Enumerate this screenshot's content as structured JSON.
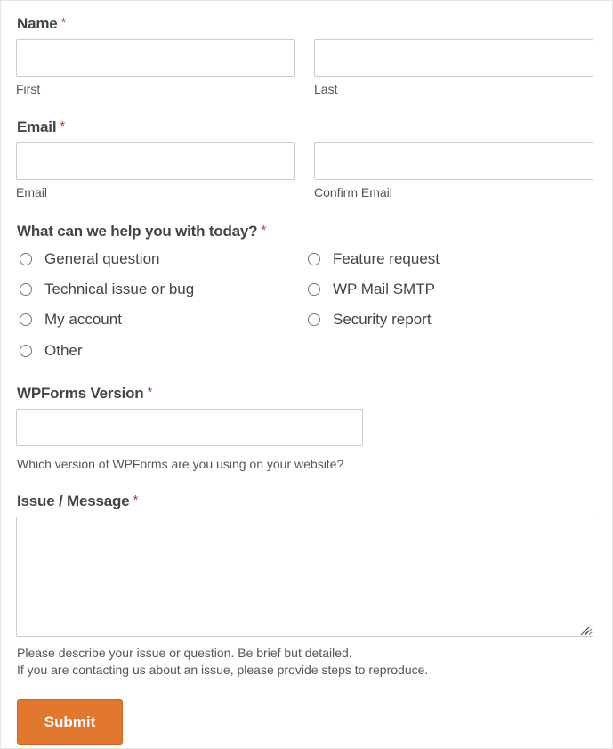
{
  "form": {
    "required_marker": "*",
    "name": {
      "label": "Name",
      "first": {
        "sublabel": "First",
        "value": "",
        "placeholder": ""
      },
      "last": {
        "sublabel": "Last",
        "value": "",
        "placeholder": ""
      }
    },
    "email": {
      "label": "Email",
      "primary": {
        "sublabel": "Email",
        "value": "",
        "placeholder": ""
      },
      "confirm": {
        "sublabel": "Confirm Email",
        "value": "",
        "placeholder": ""
      }
    },
    "help_topic": {
      "label": "What can we help you with today?",
      "options": [
        {
          "label": "General question",
          "selected": false
        },
        {
          "label": "Technical issue or bug",
          "selected": false
        },
        {
          "label": "My account",
          "selected": false
        },
        {
          "label": "Other",
          "selected": false
        },
        {
          "label": "Feature request",
          "selected": false
        },
        {
          "label": "WP Mail SMTP",
          "selected": false
        },
        {
          "label": "Security report",
          "selected": false
        }
      ]
    },
    "version": {
      "label": "WPForms Version",
      "value": "",
      "placeholder": "",
      "description": "Which version of WPForms are you using on your website?"
    },
    "message": {
      "label": "Issue / Message",
      "value": "",
      "placeholder": "",
      "description_line1": "Please describe your issue or question. Be brief but detailed.",
      "description_line2": "If you are contacting us about an issue, please provide steps to reproduce."
    },
    "submit_label": "Submit"
  },
  "colors": {
    "accent": "#e27730",
    "required": "#e02b27",
    "text": "#444444",
    "border": "#cccccc"
  }
}
